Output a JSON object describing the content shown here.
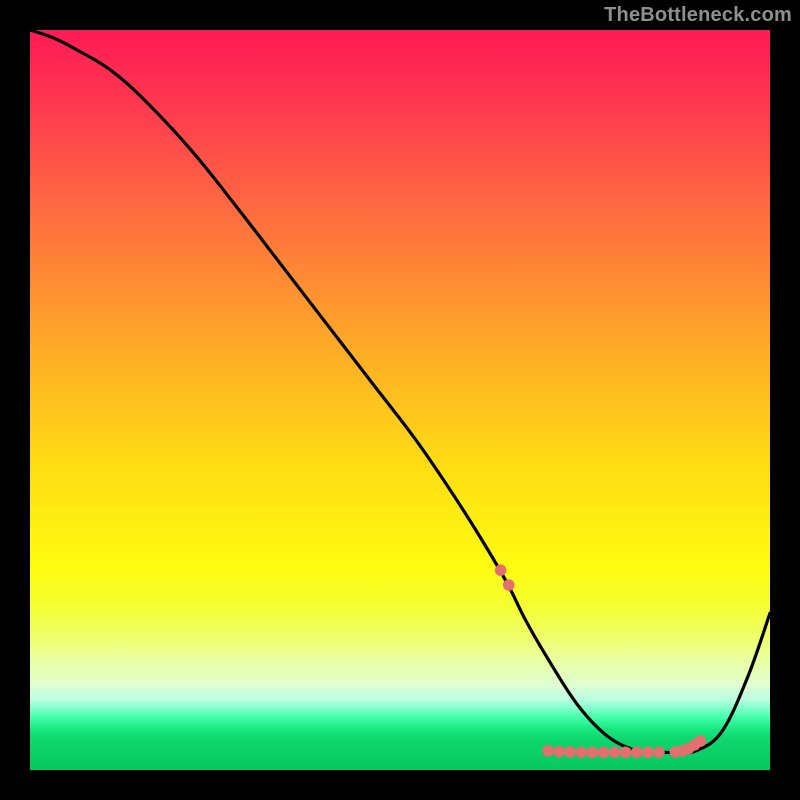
{
  "watermark": "TheBottleneck.com",
  "chart_data": {
    "type": "line",
    "title": "",
    "xlabel": "",
    "ylabel": "",
    "xlim": [
      0,
      100
    ],
    "ylim": [
      0,
      100
    ],
    "grid": false,
    "legend": false,
    "background_gradient": {
      "stops": [
        {
          "offset": 0.0,
          "color": "#ff1a55"
        },
        {
          "offset": 0.1,
          "color": "#ff3850"
        },
        {
          "offset": 0.25,
          "color": "#ff6d3f"
        },
        {
          "offset": 0.45,
          "color": "#ffb224"
        },
        {
          "offset": 0.6,
          "color": "#ffe012"
        },
        {
          "offset": 0.73,
          "color": "#fffc10"
        },
        {
          "offset": 0.78,
          "color": "#f5ff33"
        },
        {
          "offset": 0.82,
          "color": "#f0ff6a"
        },
        {
          "offset": 0.85,
          "color": "#eaffa0"
        },
        {
          "offset": 0.885,
          "color": "#dfffd0"
        },
        {
          "offset": 0.905,
          "color": "#b8ffe2"
        },
        {
          "offset": 0.918,
          "color": "#7affc6"
        },
        {
          "offset": 0.93,
          "color": "#3effa8"
        },
        {
          "offset": 0.945,
          "color": "#17e87e"
        },
        {
          "offset": 0.96,
          "color": "#0dd66c"
        },
        {
          "offset": 1.0,
          "color": "#07c85e"
        }
      ]
    },
    "series": [
      {
        "name": "bottleneck-curve",
        "color": "#000000",
        "x": [
          0,
          3,
          6,
          11,
          16,
          22,
          28,
          34,
          40,
          46,
          52,
          57,
          61,
          64.5,
          67,
          70,
          74,
          78,
          82,
          85,
          87.5,
          90,
          93.5,
          97,
          100
        ],
        "y": [
          100,
          99,
          97.5,
          94.5,
          90,
          83.5,
          76,
          68.2,
          60.4,
          52.6,
          44.8,
          37.5,
          31.2,
          25.2,
          20.2,
          15,
          8.8,
          4.6,
          2.6,
          2.4,
          2.4,
          2.6,
          5.2,
          12.6,
          21.2
        ]
      }
    ],
    "markers": {
      "name": "optimal-range-dots",
      "color": "#e36f6f",
      "x": [
        63.6,
        64.7,
        70.0,
        71.5,
        73.0,
        74.5,
        76.0,
        77.5,
        79.0,
        80.5,
        82.0,
        83.5,
        85.0,
        87.2,
        88.2,
        89.0,
        89.8,
        90.6
      ],
      "y": [
        27.0,
        25.0,
        2.6,
        2.5,
        2.45,
        2.4,
        2.4,
        2.4,
        2.4,
        2.4,
        2.4,
        2.4,
        2.4,
        2.45,
        2.6,
        2.9,
        3.4,
        3.9
      ]
    }
  }
}
